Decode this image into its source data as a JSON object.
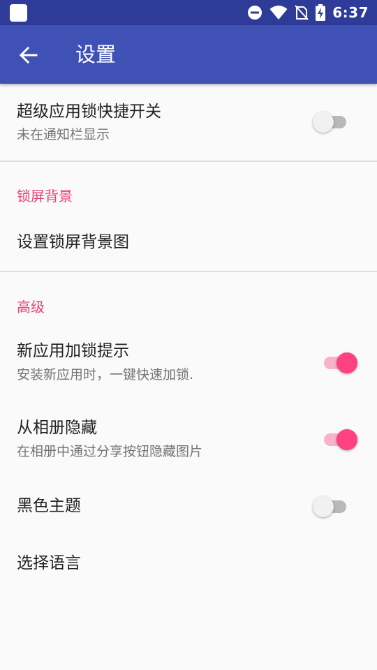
{
  "status_bar": {
    "time": "6:37",
    "icons": [
      "app-notification-icon",
      "do-not-disturb-icon",
      "wifi-icon",
      "no-sim-icon",
      "battery-charging-icon"
    ]
  },
  "app_bar": {
    "title": "设置",
    "back_icon": "arrow-back-icon"
  },
  "settings": {
    "super_lock": {
      "title": "超级应用锁快捷开关",
      "subtitle": "未在通知栏显示",
      "enabled": false
    },
    "lock_background": {
      "header": "锁屏背景",
      "set_background": "设置锁屏背景图"
    },
    "advanced": {
      "header": "高级",
      "new_app_lock": {
        "title": "新应用加锁提示",
        "subtitle": "安装新应用时，一键快速加锁.",
        "enabled": true
      },
      "hide_from_album": {
        "title": "从相册隐藏",
        "subtitle": "在相册中通过分享按钮隐藏图片",
        "enabled": true
      },
      "dark_theme": {
        "title": "黑色主题",
        "enabled": false
      },
      "language": {
        "title": "选择语言"
      }
    }
  },
  "colors": {
    "status_bar": "#2f3b98",
    "app_bar": "#3f51b5",
    "accent": "#ff4081",
    "section_header": "#e9417a"
  }
}
